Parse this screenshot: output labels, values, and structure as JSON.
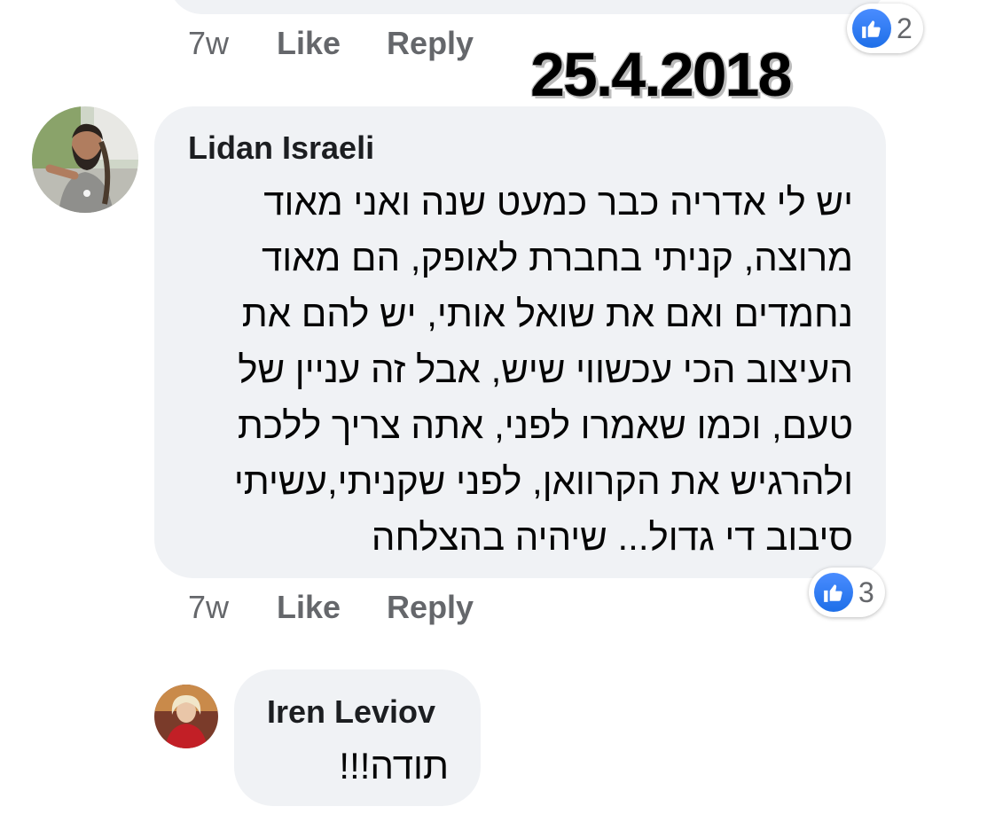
{
  "previous_comment": {
    "time": "7w",
    "like_label": "Like",
    "reply_label": "Reply",
    "reactions": {
      "icon": "thumbs-up-icon",
      "count": "2"
    }
  },
  "date_stamp": "25.4.2018",
  "comment1": {
    "author": "Lidan Israeli",
    "text_lines": [
      "יש לי אדריה כבר כמעט שנה ואני מאוד",
      "מרוצה, קניתי בחברת לאופק, הם מאוד",
      "נחמדים ואם את שואל אותי, יש להם את",
      "העיצוב הכי עכשווי שיש, אבל זה עניין של",
      "טעם, וכמו שאמרו לפני, אתה צריך ללכת",
      "ולהרגיש את הקרוואן, לפני שקניתי,עשיתי",
      "סיבוב די גדול... שיהיה בהצלחה"
    ],
    "time": "7w",
    "like_label": "Like",
    "reply_label": "Reply",
    "reactions": {
      "icon": "thumbs-up-icon",
      "count": "3"
    }
  },
  "reply1": {
    "author": "Iren Leviov",
    "text": "תודה!!!"
  },
  "colors": {
    "bubble": "#f0f2f5",
    "action_text": "#65676b",
    "like_blue": "#1e6fe8"
  }
}
